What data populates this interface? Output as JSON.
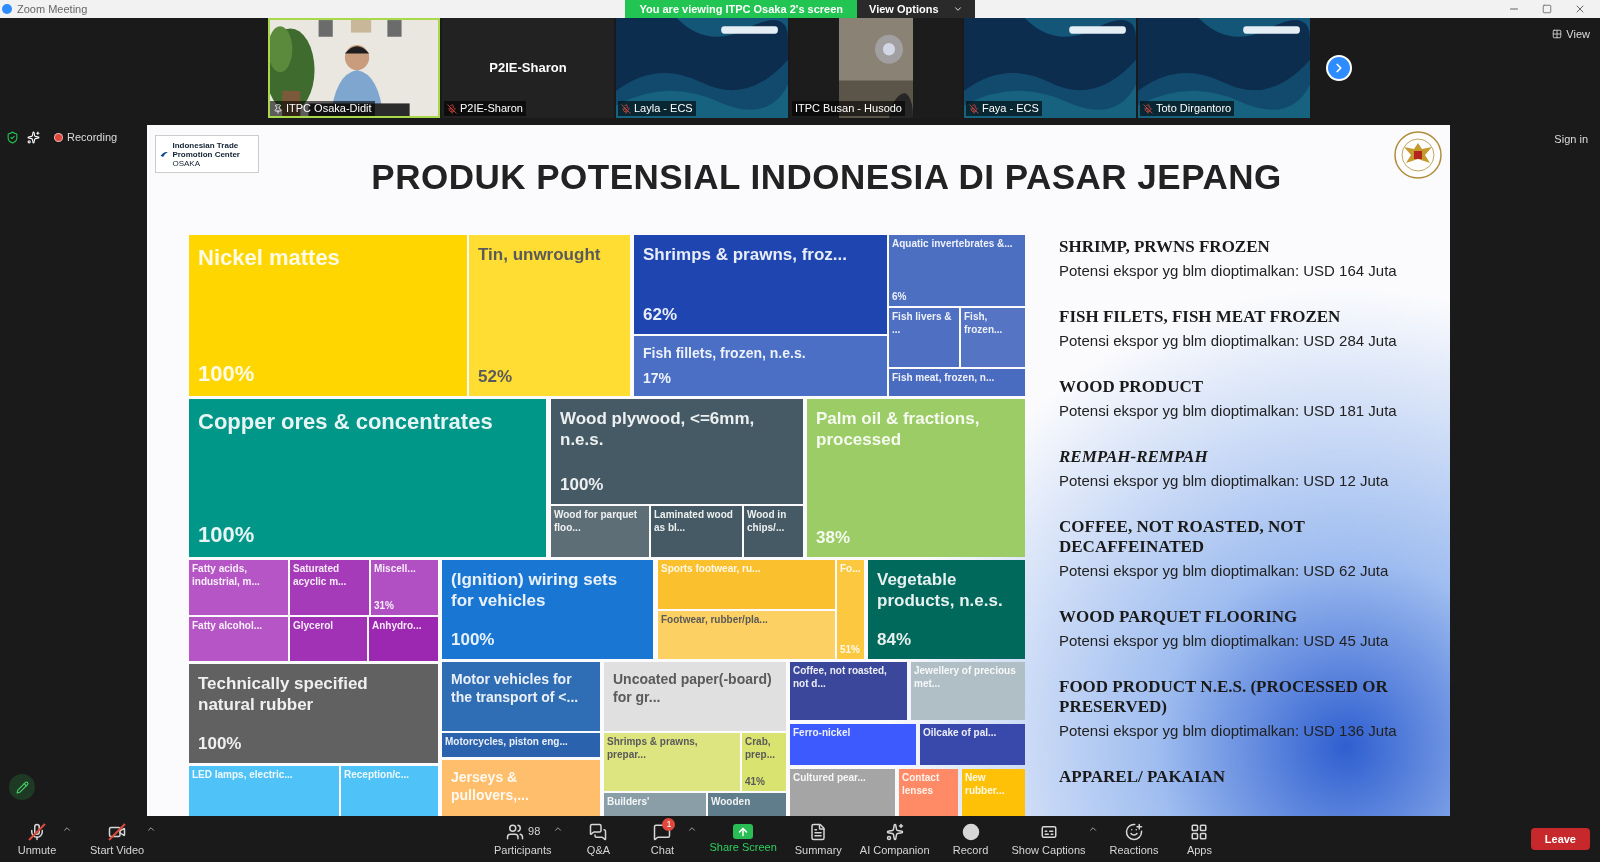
{
  "window": {
    "title": "Zoom Meeting"
  },
  "share_banner": {
    "text": "You are viewing ITPC Osaka 2's screen",
    "button": "View Options"
  },
  "view_button": "View",
  "participants_strip": [
    {
      "name": "ITPC Osaka-Didit",
      "kind": "office",
      "muted": false,
      "pinned": true,
      "active": true
    },
    {
      "name": "P2IE-Sharon",
      "kind": "name_only",
      "muted": true,
      "pinned": false,
      "active": false,
      "display_name": "P2IE-Sharon"
    },
    {
      "name": "Layla - ECS",
      "kind": "banner",
      "muted": true,
      "pinned": false,
      "active": false
    },
    {
      "name": "ITPC Busan - Husodo",
      "kind": "dim_room",
      "muted": false,
      "pinned": false,
      "active": false
    },
    {
      "name": "Faya - ECS",
      "kind": "banner",
      "muted": true,
      "pinned": false,
      "active": false
    },
    {
      "name": "Toto Dirgantoro",
      "kind": "banner",
      "muted": true,
      "pinned": false,
      "active": false
    }
  ],
  "recording": {
    "label": "Recording"
  },
  "sign_in": "Sign in",
  "slide": {
    "logo": {
      "name": "Indonesian Trade Promotion Center",
      "city": "OSAKA"
    },
    "title": "PRODUK POTENSIAL INDONESIA DI PASAR JEPANG",
    "treemap": {
      "tiles": [
        {
          "label": "Nickel mattes",
          "percent": "100%",
          "color": "#ffd600"
        },
        {
          "label": "Tin, unwrought",
          "percent": "52%",
          "color": "#ffdd33"
        },
        {
          "label": "Shrimps & prawns, froz...",
          "percent": "62%",
          "color": "#1e45b0"
        },
        {
          "label": "Fish fillets, frozen, n.e.s.",
          "percent": "17%",
          "color": "#4a6fc4"
        },
        {
          "label": "Aquatic invertebrates &...",
          "percent": "6%",
          "color": "#4d6fc2"
        },
        {
          "label": "Fish livers & ...",
          "color": "#4f70c2"
        },
        {
          "label": "Fish, frozen...",
          "color": "#5574c4"
        },
        {
          "label": "Fish meat, frozen, n...",
          "color": "#4a6cc0"
        },
        {
          "label": "Copper ores & concentrates",
          "percent": "100%",
          "color": "#009688"
        },
        {
          "label": "Wood plywood, <=6mm, n.e.s.",
          "percent": "100%",
          "color": "#455a64"
        },
        {
          "label": "Wood for parquet floo...",
          "color": "#5d6e77"
        },
        {
          "label": "Laminated wood as bl...",
          "color": "#455a64"
        },
        {
          "label": "Wood in chips/...",
          "color": "#455a64"
        },
        {
          "label": "Palm oil & fractions, processed",
          "percent": "38%",
          "color": "#9ccc65"
        },
        {
          "label": "Fatty acids, industrial, m...",
          "color": "#b655c6"
        },
        {
          "label": "Saturated acyclic m...",
          "color": "#a53bb8"
        },
        {
          "label": "Miscell...",
          "percent": "31%",
          "color": "#b050c2"
        },
        {
          "label": "Fatty alcohol...",
          "color": "#b655c6"
        },
        {
          "label": "Glycerol",
          "color": "#a131b5"
        },
        {
          "label": "Anhydro...",
          "color": "#9c27b0"
        },
        {
          "label": "(Ignition) wiring sets for vehicles",
          "percent": "100%",
          "color": "#1976d2"
        },
        {
          "label": "Sports footwear, ru...",
          "color": "#fbc02d"
        },
        {
          "label": "Footwear, rubber/pla...",
          "color": "#fcd063"
        },
        {
          "label": "Fo...",
          "percent": "51%",
          "color": "#fcc83f"
        },
        {
          "label": "Vegetable products, n.e.s.",
          "percent": "84%",
          "color": "#00695c"
        },
        {
          "label": "Technically specified natural rubber",
          "percent": "100%",
          "color": "#616161"
        },
        {
          "label": "LED lamps, electric...",
          "color": "#4fc3f7"
        },
        {
          "label": "Reception/c...",
          "color": "#4fc3f7"
        },
        {
          "label": "Motor vehicles for the transport of <...",
          "color": "#2f6db5"
        },
        {
          "label": "Motorcycles, piston eng...",
          "color": "#2a62ad"
        },
        {
          "label": "Jerseys & pullovers,...",
          "color": "#ffbe6b"
        },
        {
          "label": "Uncoated paper(-board) for gr...",
          "color": "#e0e0e0"
        },
        {
          "label": "Shrimps & prawns, prepar...",
          "color": "#dde580"
        },
        {
          "label": "Crab, prep...",
          "percent": "41%",
          "color": "#d9e36f"
        },
        {
          "label": "Builders'",
          "color": "#8a9ea8"
        },
        {
          "label": "Wooden",
          "color": "#607d8b"
        },
        {
          "label": "Coffee, not roasted, not d...",
          "color": "#3b479b"
        },
        {
          "label": "Jewellery of precious met...",
          "color": "#b0bec5"
        },
        {
          "label": "Ferro-nickel",
          "color": "#3d5afe"
        },
        {
          "label": "Oilcake of pal...",
          "color": "#3949ab"
        },
        {
          "label": "Cultured pear...",
          "color": "#a5a5a5"
        },
        {
          "label": "Contact lenses",
          "color": "#ff8a65"
        },
        {
          "label": "New rubber...",
          "color": "#ffc107"
        }
      ]
    },
    "potentials": [
      {
        "title": "SHRIMP, PRWNS FROZEN",
        "italic": false,
        "description": "Potensi ekspor yg blm dioptimalkan: USD 164 Juta"
      },
      {
        "title": "FISH FILETS, FISH MEAT FROZEN",
        "italic": false,
        "description": "Potensi ekspor yg blm dioptimalkan: USD 284 Juta"
      },
      {
        "title": "WOOD PRODUCT",
        "italic": false,
        "description": "Potensi ekspor yg blm dioptimalkan: USD 181 Juta"
      },
      {
        "title": "REMPAH-REMPAH",
        "italic": true,
        "description": "Potensi ekspor yg blm dioptimalkan: USD 12 Juta"
      },
      {
        "title": "COFFEE, NOT ROASTED, NOT DECAFFEINATED",
        "italic": false,
        "description": "Potensi ekspor yg blm dioptimalkan: USD 62 Juta"
      },
      {
        "title": "WOOD PARQUET FLOORING",
        "italic": false,
        "description": "Potensi ekspor yg blm dioptimalkan: USD 45 Juta"
      },
      {
        "title": "FOOD PRODUCT N.E.S. (PROCESSED OR PRESERVED)",
        "italic": false,
        "description": "Potensi ekspor yg blm dioptimalkan: USD 136 Juta"
      },
      {
        "title": "APPAREL/ PAKAIAN",
        "italic": false
      }
    ]
  },
  "toolbar": {
    "items": [
      {
        "kind": "audio",
        "label": "Unmute",
        "off": true,
        "menu": true
      },
      {
        "kind": "video",
        "label": "Start Video",
        "off": true,
        "menu": true
      },
      {
        "kind": "participants",
        "label": "Participants",
        "count": "98",
        "off": false,
        "menu": true
      },
      {
        "kind": "qa",
        "label": "Q&A",
        "off": false,
        "menu": false
      },
      {
        "kind": "chat",
        "label": "Chat",
        "badge": "1",
        "off": false,
        "menu": true
      },
      {
        "kind": "share",
        "label": "Share Screen",
        "off": false,
        "menu": false
      },
      {
        "kind": "summary",
        "label": "Summary",
        "off": false,
        "menu": false
      },
      {
        "kind": "ai",
        "label": "AI Companion",
        "off": false,
        "menu": false
      },
      {
        "kind": "record",
        "label": "Record",
        "off": false,
        "menu": false
      },
      {
        "kind": "captions",
        "label": "Show Captions",
        "off": false,
        "menu": true
      },
      {
        "kind": "reactions",
        "label": "Reactions",
        "off": false,
        "menu": false
      },
      {
        "kind": "apps",
        "label": "Apps",
        "off": false,
        "menu": false
      }
    ],
    "leave": "Leave"
  }
}
